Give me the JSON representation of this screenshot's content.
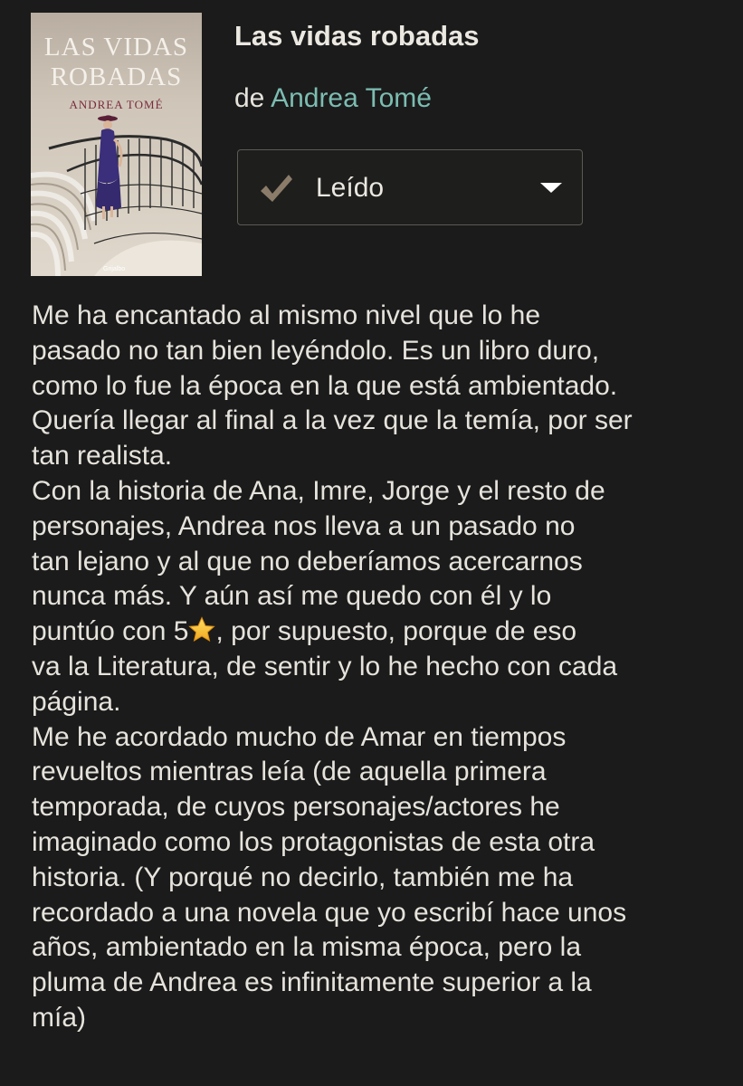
{
  "book": {
    "cover": {
      "title_line1": "LAS VIDAS",
      "title_line2": "ROBADAS",
      "author": "ANDREA TOMÉ",
      "publisher": "Grijalbo",
      "title_color": "#f4f0ea",
      "author_color": "#7a2a3c"
    },
    "title": "Las vidas robadas",
    "by_label": "de",
    "author": "Andrea Tomé",
    "author_color": "#7cbdb2"
  },
  "shelf_status": {
    "label": "Leído",
    "check_icon": "check-icon",
    "check_color": "#8b7c69",
    "dropdown_icon": "caret-down-icon"
  },
  "review": {
    "lines": [
      "Me ha encantado al mismo nivel que lo he",
      "pasado no tan bien leyéndolo. Es un libro duro,",
      "como lo fue la época en la que está ambientado.",
      "Quería llegar al final a la vez que la temía, por ser",
      "tan realista.",
      "Con la historia de Ana, Imre, Jorge y el resto de",
      "personajes, Andrea nos lleva a un pasado no",
      "tan lejano y al que no deberíamos acercarnos",
      "nunca más. Y aún así me quedo con él y lo"
    ],
    "star_line_before": "puntúo con 5",
    "star_icon": "star-emoji-icon",
    "star_line_after": ", por supuesto, porque de eso",
    "lines_after": [
      "va la Literatura, de sentir y lo he hecho con cada",
      "página.",
      "Me he acordado mucho de Amar en tiempos",
      "revueltos mientras leía (de aquella primera",
      "temporada, de cuyos personajes/actores he",
      "imaginado como los protagonistas de esta otra",
      "historia. (Y porqué no decirlo, también me ha",
      "recordado a una novela que yo escribí hace unos",
      "años, ambientado en la misma época, pero la",
      "pluma de Andrea es infinitamente superior a la",
      "mía)"
    ]
  },
  "colors": {
    "background": "#1b1b1b",
    "text": "#e6e3dc"
  }
}
